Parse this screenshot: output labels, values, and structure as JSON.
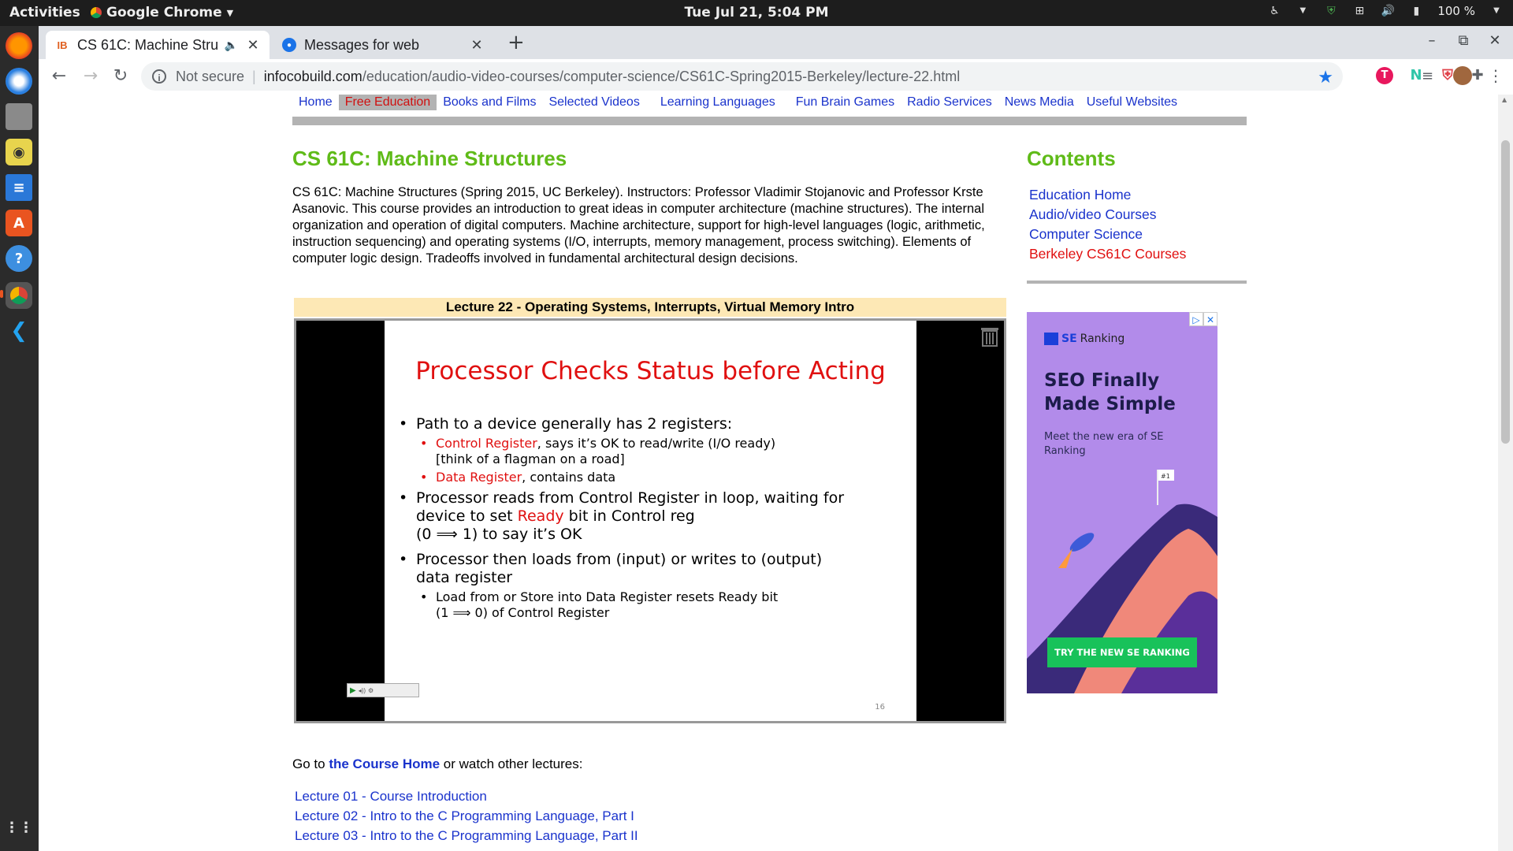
{
  "system": {
    "activities": "Activities",
    "app_name": "Google Chrome",
    "clock": "Tue Jul 21,  5:04 PM",
    "battery": "100 %"
  },
  "browser": {
    "tabs": [
      {
        "title": "CS 61C: Machine Struc",
        "active": true
      },
      {
        "title": "Messages for web",
        "active": false
      }
    ],
    "new_tab": "+",
    "security": "Not secure",
    "url_host": "infocobuild.com",
    "url_path": "/education/audio-video-courses/computer-science/CS61C-Spring2015-Berkeley/lecture-22.html"
  },
  "nav": {
    "items": [
      "Home",
      "Free Education",
      "Books and Films",
      "Selected Videos",
      "Learning Languages",
      "Fun Brain Games",
      "Radio Services",
      "News Media",
      "Useful Websites"
    ],
    "selected": "Free Education"
  },
  "main": {
    "title": "CS 61C: Machine Structures",
    "intro": "CS 61C: Machine Structures (Spring 2015, UC Berkeley). Instructors: Professor Vladimir Stojanovic and Professor Krste Asanovic. This course provides an introduction to great ideas in computer architecture (machine structures). The internal organization and operation of digital computers. Machine architecture, support for high-level languages (logic, arithmetic, instruction sequencing) and operating systems (I/O, interrupts, memory management, process switching). Elements of computer logic design. Tradeoffs involved in fundamental architectural design decisions.",
    "lecture_title": "Lecture 22 - Operating Systems, Interrupts, Virtual Memory Intro",
    "slide": {
      "title": "Processor Checks Status before Acting",
      "b1": "Path to a device generally has 2 registers:",
      "b1a_red": "Control Register",
      "b1a_rest": ", says it’s OK to read/write  (I/O ready) [think of a flagman on a road]",
      "b1b_red": "Data Register",
      "b1b_rest": ", contains data",
      "b2_pre": "Processor reads from Control Register in loop, waiting for device to set ",
      "b2_red": "Ready",
      "b2_post": " bit in Control reg",
      "b2_line2": "(0 ⟹ 1) to say it’s OK",
      "b3": "Processor then loads from (input) or writes to (output) data register",
      "b3a": "Load from or Store into Data Register resets Ready bit",
      "b3a_line2": "(1 ⟹  0) of Control Register",
      "page_number": "16"
    },
    "goto_pre": "Go to ",
    "goto_link": "the Course Home",
    "goto_post": " or watch other lectures:",
    "lectures": [
      "Lecture 01 - Course Introduction",
      "Lecture 02 - Intro to the C Programming Language, Part I",
      "Lecture 03 - Intro to the C Programming Language, Part II"
    ]
  },
  "sidebar": {
    "title": "Contents",
    "links": [
      "Education Home",
      "Audio/video Courses",
      "Computer Science",
      "Berkeley CS61C Courses"
    ]
  },
  "ad": {
    "brand_se": "SE",
    "brand_rest": "Ranking",
    "headline": "SEO Finally Made Simple",
    "sub": "Meet the new era of SE Ranking",
    "cta": "TRY THE NEW SE RANKING",
    "flag": "#1"
  },
  "colors": {
    "accent_green": "#5fbb18",
    "link_blue": "#1a33cc",
    "active_red": "#e01010",
    "chrome_frame": "#dee1e6"
  }
}
